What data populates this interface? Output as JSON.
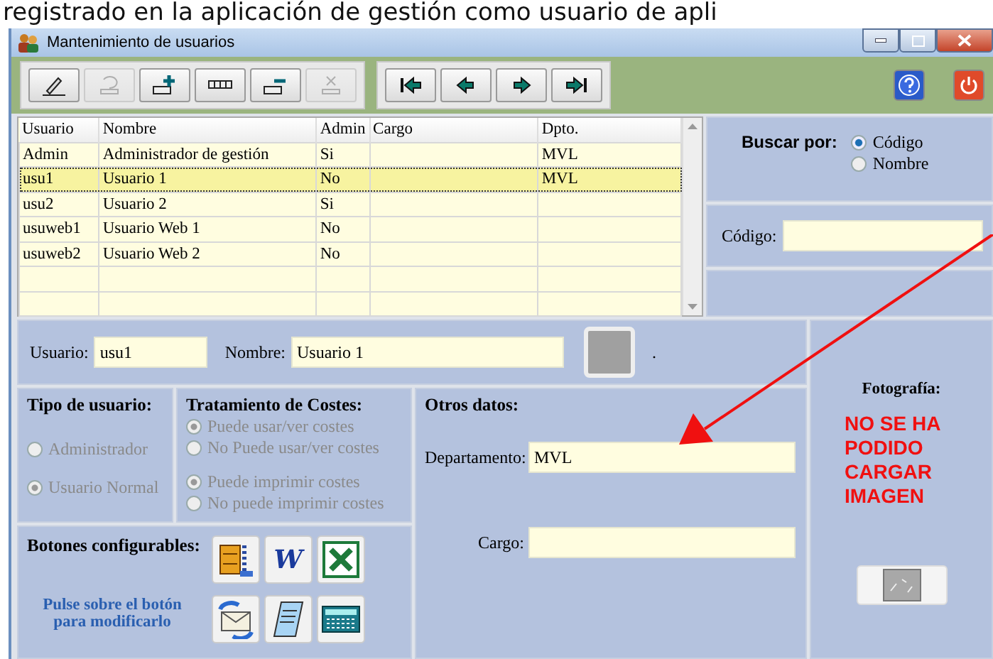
{
  "caption": "registrado en la aplicación de gestión como usuario de apli",
  "window": {
    "title": "Mantenimiento de usuarios"
  },
  "toolbar": {
    "edit_buttons": [
      {
        "kind": "edit",
        "disabled": false
      },
      {
        "kind": "undo",
        "disabled": true
      },
      {
        "kind": "add",
        "disabled": false
      },
      {
        "kind": "list",
        "disabled": false
      },
      {
        "kind": "remove",
        "disabled": false
      },
      {
        "kind": "delete",
        "disabled": true
      }
    ],
    "nav_buttons": [
      {
        "kind": "first"
      },
      {
        "kind": "prev"
      },
      {
        "kind": "next"
      },
      {
        "kind": "last"
      }
    ],
    "right_buttons": [
      {
        "kind": "help"
      },
      {
        "kind": "exit"
      }
    ]
  },
  "table": {
    "columns": [
      "Usuario",
      "Nombre",
      "Admin",
      "Cargo",
      "Dpto."
    ],
    "rows": [
      {
        "cells": [
          "Admin",
          "Administrador de gestión",
          "Si",
          "",
          "MVL"
        ],
        "selected": false
      },
      {
        "cells": [
          "usu1",
          "Usuario 1",
          "No",
          "",
          "MVL"
        ],
        "selected": true
      },
      {
        "cells": [
          "usu2",
          "Usuario 2",
          "Si",
          "",
          ""
        ],
        "selected": false
      },
      {
        "cells": [
          "usuweb1",
          "Usuario Web 1",
          "No",
          "",
          ""
        ],
        "selected": false
      },
      {
        "cells": [
          "usuweb2",
          "Usuario Web 2",
          "No",
          "",
          ""
        ],
        "selected": false
      }
    ]
  },
  "search": {
    "label": "Buscar por:",
    "options": [
      {
        "label": "Código",
        "selected": true
      },
      {
        "label": "Nombre",
        "selected": false
      }
    ],
    "field_label": "Código:"
  },
  "user": {
    "usuario_label": "Usuario:",
    "usuario_value": "usu1",
    "nombre_label": "Nombre:",
    "nombre_value": "Usuario 1",
    "mark": "."
  },
  "tipo_usuario": {
    "title": "Tipo de usuario:",
    "disabled": true,
    "options": [
      {
        "label": "Administrador",
        "selected": false
      },
      {
        "label": "Usuario Normal",
        "selected": true
      }
    ]
  },
  "costes": {
    "title": "Tratamiento de Costes:",
    "disabled": true,
    "groups": [
      [
        {
          "label": "Puede usar/ver costes",
          "selected": true
        },
        {
          "label": "No Puede usar/ver costes",
          "selected": false
        }
      ],
      [
        {
          "label": "Puede imprimir costes",
          "selected": true
        },
        {
          "label": "No puede imprimir costes",
          "selected": false
        }
      ]
    ]
  },
  "botones": {
    "title": "Botones configurables:",
    "hint": "Pulse sobre el botón para modificarlo",
    "buttons": [
      {
        "kind": "archive"
      },
      {
        "kind": "word",
        "label": "W"
      },
      {
        "kind": "excel"
      },
      {
        "kind": "mail"
      },
      {
        "kind": "notepad"
      },
      {
        "kind": "calculator"
      }
    ]
  },
  "otros": {
    "title": "Otros datos:",
    "fields": [
      {
        "label": "Departamento:",
        "value": "MVL"
      },
      {
        "label": "Cargo:"
      }
    ]
  },
  "foto": {
    "title": "Fotografía:",
    "message": "NO SE HA PODIDO CARGAR IMAGEN"
  }
}
